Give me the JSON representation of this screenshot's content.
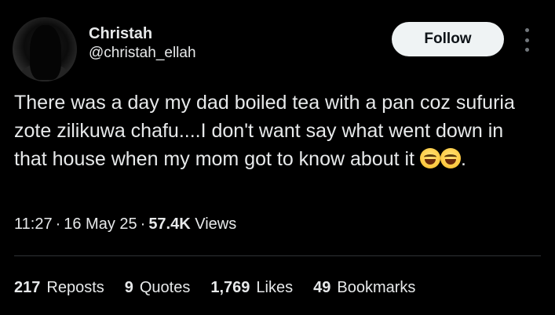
{
  "author": {
    "display_name": "Christah",
    "handle": "@christah_ellah"
  },
  "follow_label": "Follow",
  "tweet": {
    "text": "There was a day my dad boiled tea with a pan coz sufuria zote zilikuwa chafu....I don't want say what went down in that house when my mom got to know about it",
    "emojis": [
      "grinning-squinting-face",
      "grinning-squinting-face"
    ],
    "trailing": "."
  },
  "meta": {
    "time": "11:27",
    "date": "16 May 25",
    "views_count": "57.4K",
    "views_label": "Views",
    "separator": "·"
  },
  "stats": {
    "reposts": {
      "count": "217",
      "label": "Reposts"
    },
    "quotes": {
      "count": "9",
      "label": "Quotes"
    },
    "likes": {
      "count": "1,769",
      "label": "Likes"
    },
    "bookmarks": {
      "count": "49",
      "label": "Bookmarks"
    }
  },
  "colors": {
    "background": "#000000",
    "text": "#e7e9ea",
    "secondary": "#71767b",
    "divider": "#2f3336",
    "button_bg": "#eff3f4",
    "button_text": "#0f1419"
  }
}
